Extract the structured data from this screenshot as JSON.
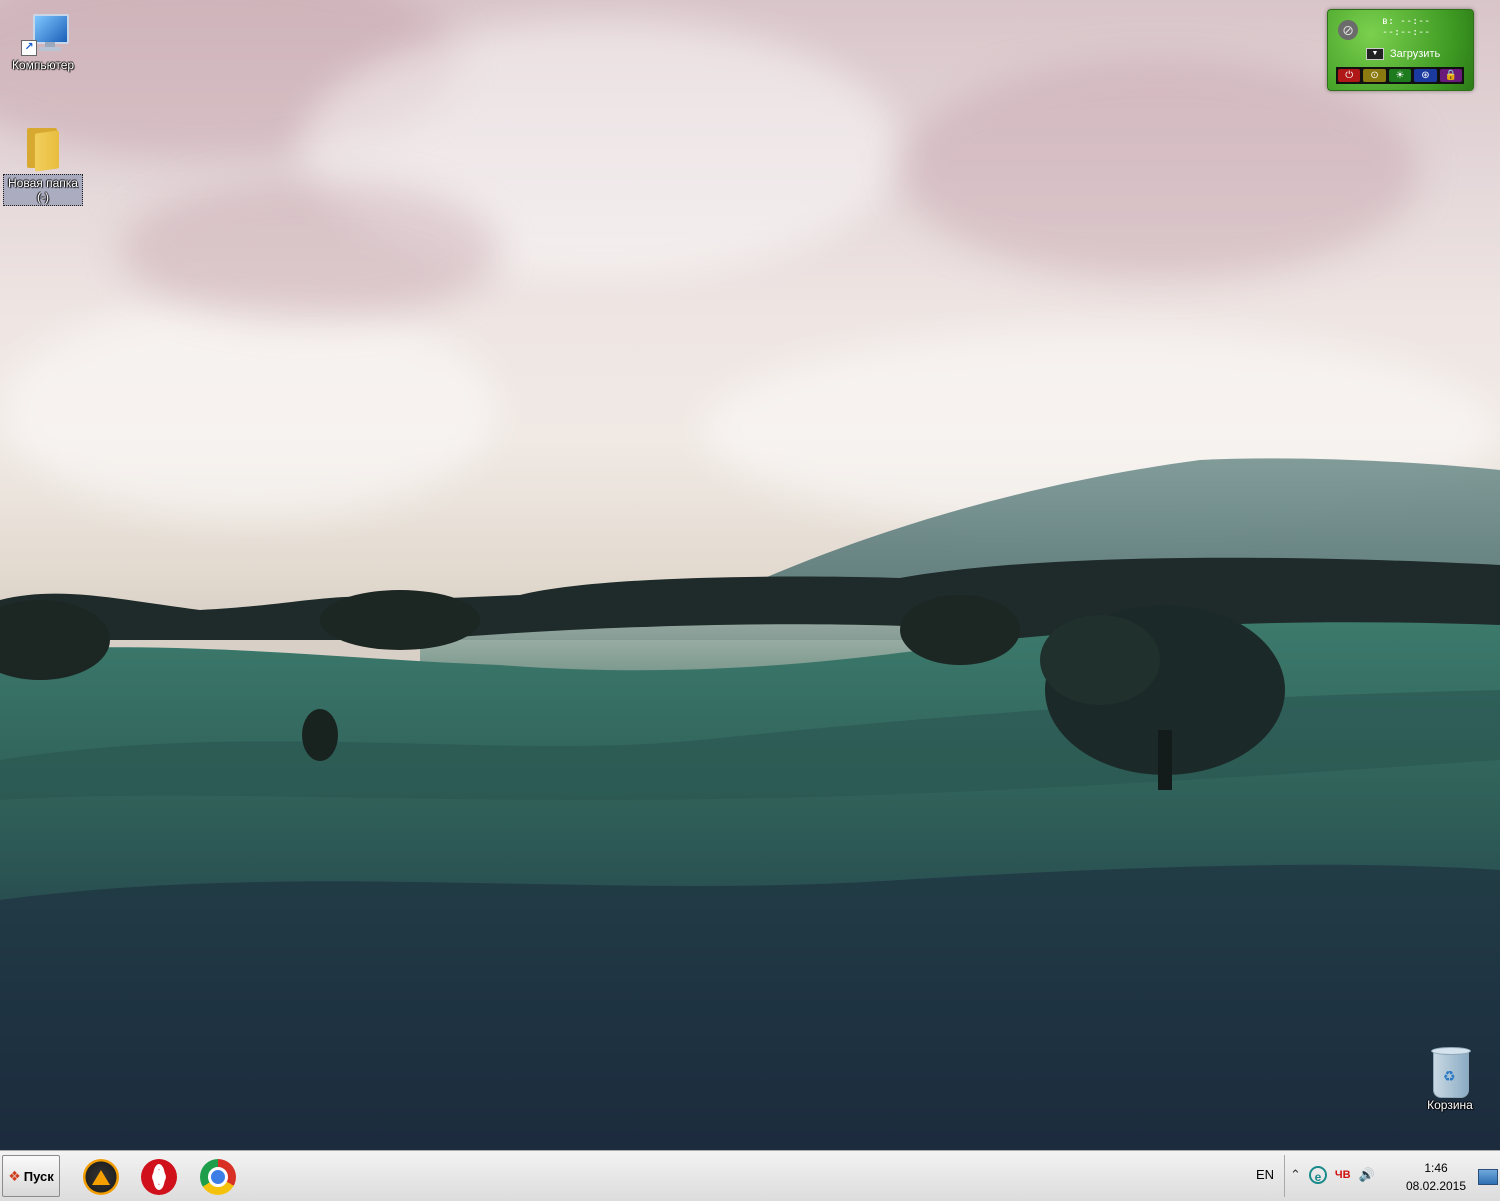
{
  "desktop": {
    "icons": [
      {
        "label": "Компьютер"
      },
      {
        "label": "Новая папка",
        "sublabel": "(-)"
      },
      {
        "label": "Корзина"
      }
    ]
  },
  "gadget": {
    "timer_line1": "в: --:--",
    "timer_line2": "--:--:--",
    "load_label": "Загрузить",
    "dropdown_glyph": "▼",
    "buttons": [
      "⏻",
      "⊙",
      "☀",
      "⊛",
      "🔒"
    ]
  },
  "taskbar": {
    "start_label": "Пуск",
    "pinned": [
      {
        "name": "AIMP"
      },
      {
        "name": "Opera"
      },
      {
        "name": "Google Chrome"
      }
    ],
    "language": "EN",
    "tray": {
      "expand_glyph": "⌃",
      "ie_glyph": "e",
      "red_text": "ЧВ",
      "volume_glyph": "🔊"
    },
    "clock": {
      "time": "1:46",
      "date": "08.02.2015"
    }
  },
  "colors": {
    "gadget_green": "#3e9a23",
    "taskbar_bg": "#e6e6e6",
    "field_green": "#2f5e55",
    "sky_pink": "#e4d7d9"
  }
}
